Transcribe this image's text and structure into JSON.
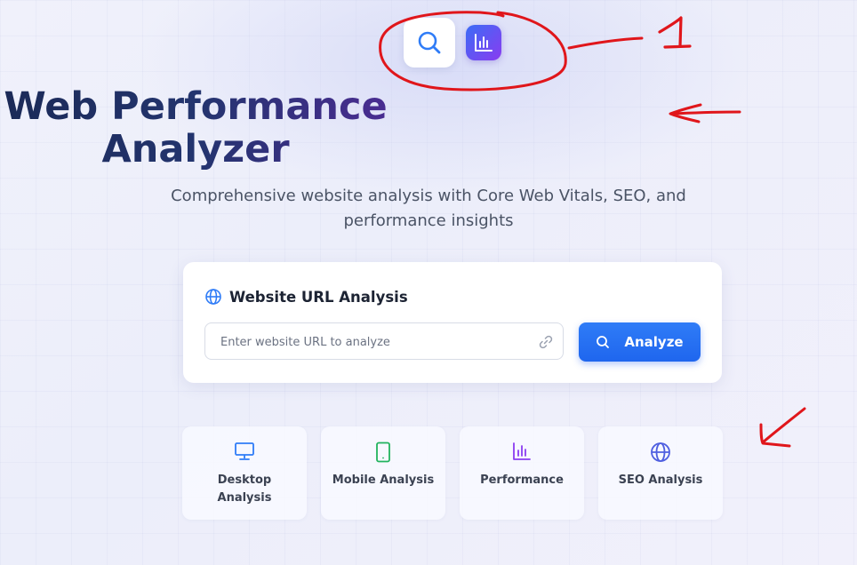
{
  "header": {
    "title": "Web Performance Analyzer",
    "subtitle": "Comprehensive website analysis with Core Web Vitals, SEO, and performance insights",
    "icons": [
      "search-icon",
      "bar-chart-icon"
    ]
  },
  "analysis_card": {
    "title": "Website URL Analysis",
    "icon": "globe-icon",
    "url_input": {
      "placeholder": "Enter website URL to analyze",
      "value": ""
    },
    "analyze_button": "Analyze"
  },
  "features": [
    {
      "label": "Desktop Analysis",
      "icon": "monitor-icon",
      "color": "#2f7cf7"
    },
    {
      "label": "Mobile Analysis",
      "icon": "smartphone-icon",
      "color": "#22b35e"
    },
    {
      "label": "Performance",
      "icon": "bar-chart-icon",
      "color": "#8a3cf0"
    },
    {
      "label": "SEO Analysis",
      "icon": "globe-icon",
      "color": "#4f5fe0"
    }
  ],
  "annotations": {
    "number_label": "1",
    "color": "#e0161b"
  },
  "colors": {
    "accent_blue": "#2f7cf7",
    "title_dark": "#1b2a57",
    "title_purple": "#4a2c92"
  }
}
